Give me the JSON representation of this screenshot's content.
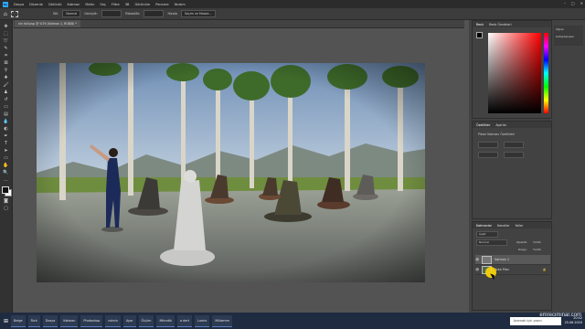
{
  "menu": {
    "logo": "Ps",
    "items": [
      "Dosya",
      "Düzenle",
      "Görüntü",
      "Katman",
      "Metin",
      "Seç",
      "Filtre",
      "3B",
      "Görünüm",
      "Pencere",
      "Yardım"
    ]
  },
  "options": {
    "items": [
      "Stil:",
      "Normal",
      "Genişlik:",
      "Yükseklik:",
      "Hizala",
      "Seçim ve Maske..."
    ]
  },
  "document": {
    "tab_label": "nin tutf.psp @ %79 (Katman 1, RGB/8) *"
  },
  "panels": {
    "color": {
      "tabs": [
        "Renk",
        "Renk Örnekleri"
      ]
    },
    "properties": {
      "tabs": [
        "Özellikler",
        "Ayarlar"
      ],
      "title": "Piksel Katmanı Özellikleri"
    },
    "layers": {
      "tabs": [
        "Katmanlar",
        "Kanallar",
        "Yollar"
      ],
      "search_placeholder": "Çeşit",
      "blend_mode": "Normal",
      "opacity_label": "Opaklık:",
      "opacity_value": "%100",
      "fill_label": "Dolgu:",
      "fill_value": "%100",
      "rows": [
        {
          "name": "Katman 1"
        },
        {
          "name": "Arka Plan"
        }
      ]
    },
    "side_labels": [
      "Öğren",
      "Kütüphaneler"
    ]
  },
  "taskbar": {
    "items": [
      "Belge",
      "Rick",
      "Dosya",
      "Katman",
      "Photoshop",
      "ndmin",
      "Ayar",
      "Ölçüm",
      "Mikrotik",
      "a dert",
      "Lumio",
      "Mükemm"
    ],
    "search": "Aramak için yazın",
    "clock_time": "20:42",
    "clock_date": "25.06.2020"
  },
  "watermark": "emreciminar.com"
}
